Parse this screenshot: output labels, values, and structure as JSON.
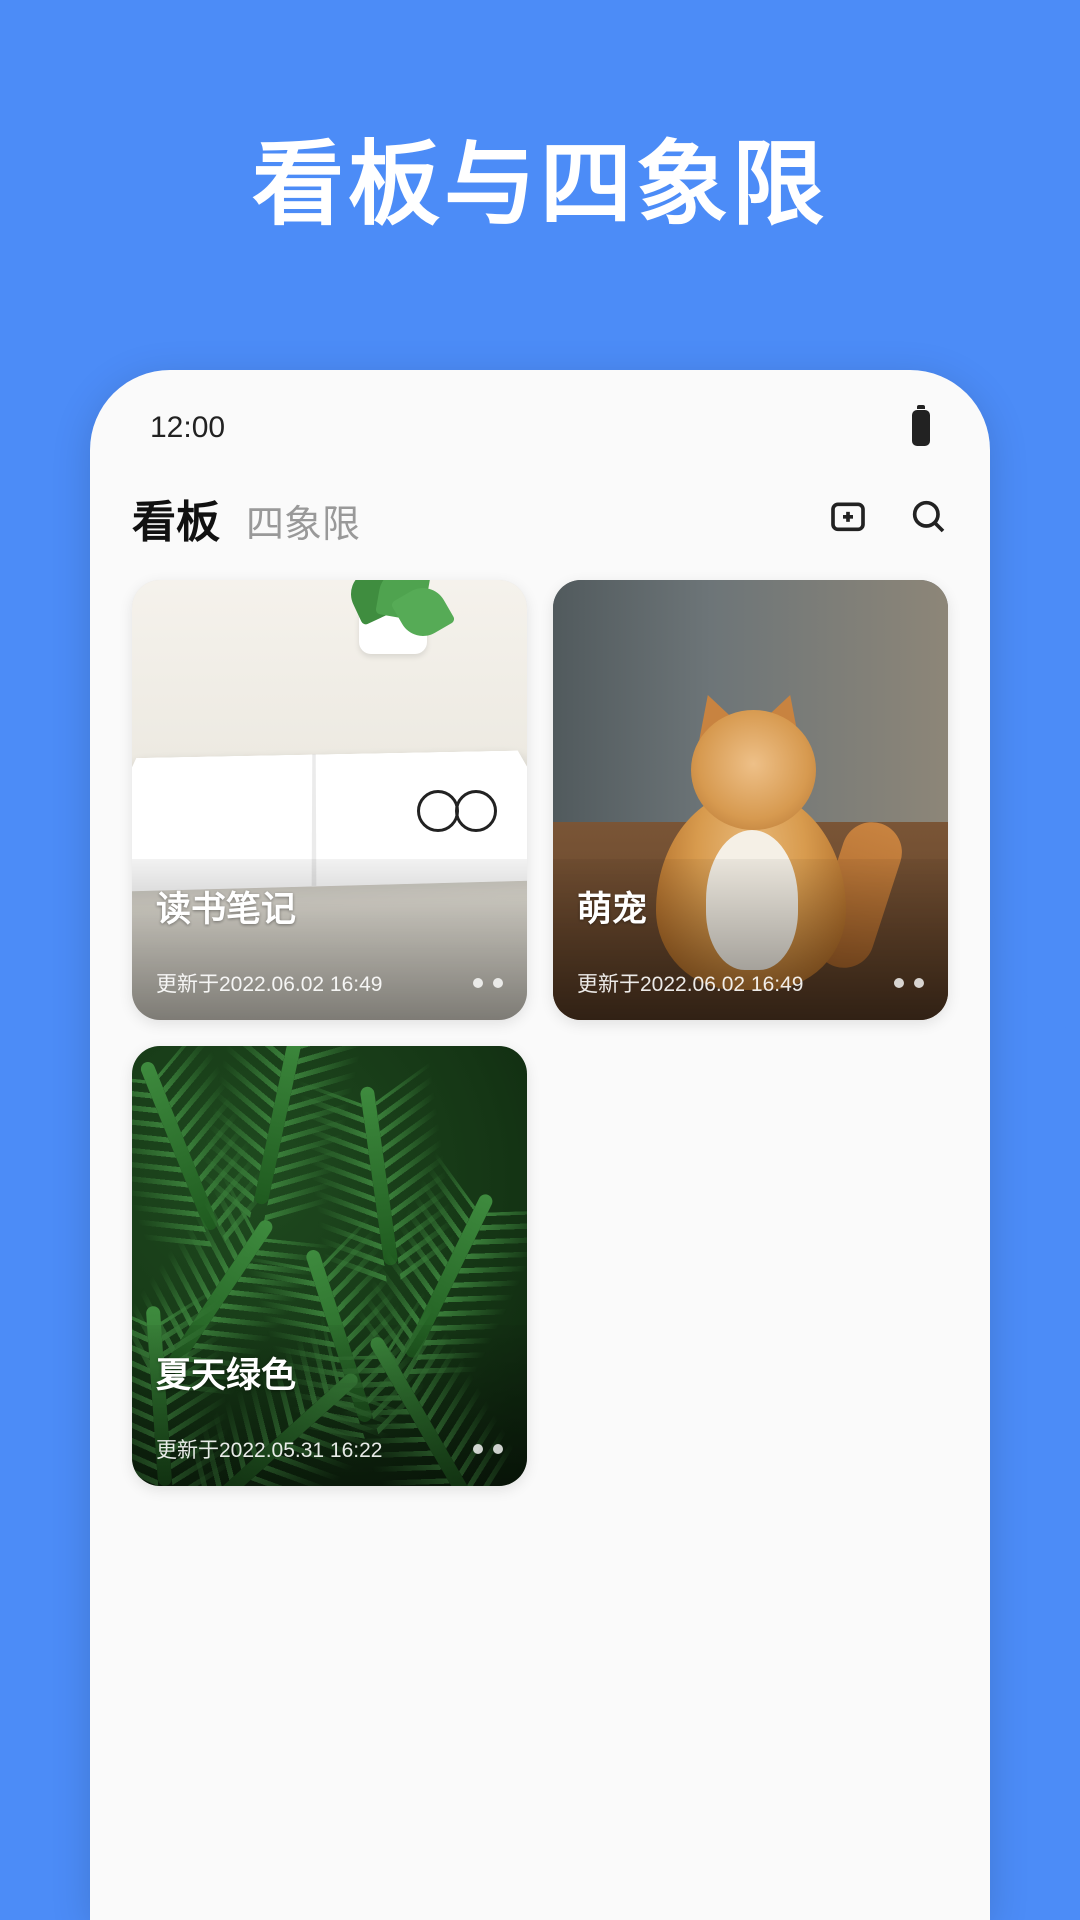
{
  "hero": {
    "title": "看板与四象限"
  },
  "status": {
    "time": "12:00"
  },
  "tabs": {
    "active": "看板",
    "inactive": "四象限"
  },
  "cards": [
    {
      "title": "读书笔记",
      "meta": "更新于2022.06.02 16:49"
    },
    {
      "title": "萌宠",
      "meta": "更新于2022.06.02 16:49"
    },
    {
      "title": "夏天绿色",
      "meta": "更新于2022.05.31 16:22"
    }
  ]
}
